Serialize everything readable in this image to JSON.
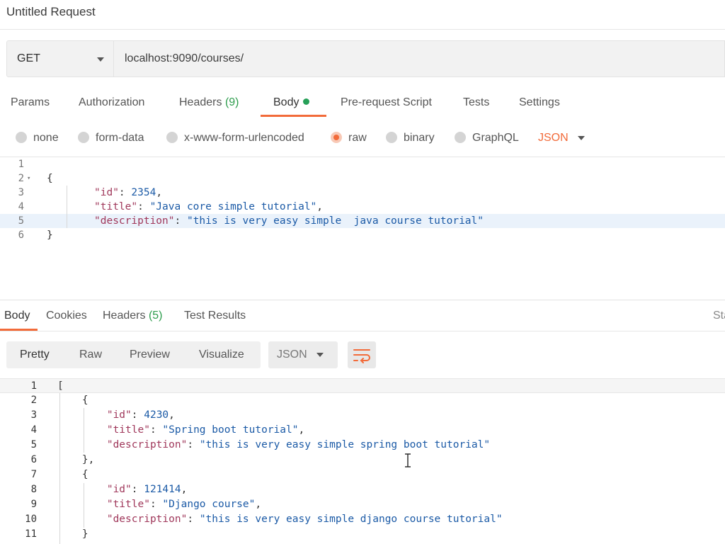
{
  "request": {
    "title": "Untitled Request",
    "method": "GET",
    "url": "localhost:9090/courses/"
  },
  "request_tabs": [
    {
      "label": "Params"
    },
    {
      "label": "Authorization"
    },
    {
      "label": "Headers",
      "count": "(9)"
    },
    {
      "label": "Body",
      "active": true
    },
    {
      "label": "Pre-request Script"
    },
    {
      "label": "Tests"
    },
    {
      "label": "Settings"
    }
  ],
  "body_types": [
    {
      "label": "none"
    },
    {
      "label": "form-data"
    },
    {
      "label": "x-www-form-urlencoded"
    },
    {
      "label": "raw",
      "selected": true
    },
    {
      "label": "binary"
    },
    {
      "label": "GraphQL"
    }
  ],
  "body_format": "JSON",
  "editor": {
    "lines": [
      {
        "n": "1",
        "text": ""
      },
      {
        "n": "2",
        "text": "{"
      },
      {
        "n": "3",
        "key": "\"id\"",
        "sep": ": ",
        "val": "2354",
        "tail": ","
      },
      {
        "n": "4",
        "key": "\"title\"",
        "sep": ": ",
        "val": "\"Java core simple tutorial\"",
        "tail": ","
      },
      {
        "n": "5",
        "key": "\"description\"",
        "sep": ": ",
        "val": "\"this is very easy simple  java course tutorial\"",
        "tail": ""
      },
      {
        "n": "6",
        "text": "}"
      }
    ]
  },
  "response_tabs": [
    {
      "label": "Body",
      "active": true
    },
    {
      "label": "Cookies"
    },
    {
      "label": "Headers",
      "count": "(5)"
    },
    {
      "label": "Test Results"
    }
  ],
  "status_truncated": "Sta",
  "view_modes": [
    "Pretty",
    "Raw",
    "Preview",
    "Visualize"
  ],
  "response_format": "JSON",
  "response": {
    "lines": [
      {
        "n": "1",
        "text": "["
      },
      {
        "n": "2",
        "text": "    {"
      },
      {
        "n": "3",
        "indent": "        ",
        "key": "\"id\"",
        "sep": ": ",
        "val": "4230",
        "tail": ","
      },
      {
        "n": "4",
        "indent": "        ",
        "key": "\"title\"",
        "sep": ": ",
        "val": "\"Spring boot tutorial\"",
        "tail": ","
      },
      {
        "n": "5",
        "indent": "        ",
        "key": "\"description\"",
        "sep": ": ",
        "val": "\"this is very easy simple spring boot tutorial\"",
        "tail": ""
      },
      {
        "n": "6",
        "text": "    },"
      },
      {
        "n": "7",
        "text": "    {"
      },
      {
        "n": "8",
        "indent": "        ",
        "key": "\"id\"",
        "sep": ": ",
        "val": "121414",
        "tail": ","
      },
      {
        "n": "9",
        "indent": "        ",
        "key": "\"title\"",
        "sep": ": ",
        "val": "\"Django course\"",
        "tail": ","
      },
      {
        "n": "10",
        "indent": "        ",
        "key": "\"description\"",
        "sep": ": ",
        "val": "\"this is very easy simple django course tutorial\"",
        "tail": ""
      },
      {
        "n": "11",
        "text": "    }"
      }
    ]
  },
  "colors": {
    "accent": "#f26b3a",
    "json_key": "#a0385b",
    "json_value": "#1b5aa6",
    "count_green": "#2e9d4d"
  }
}
